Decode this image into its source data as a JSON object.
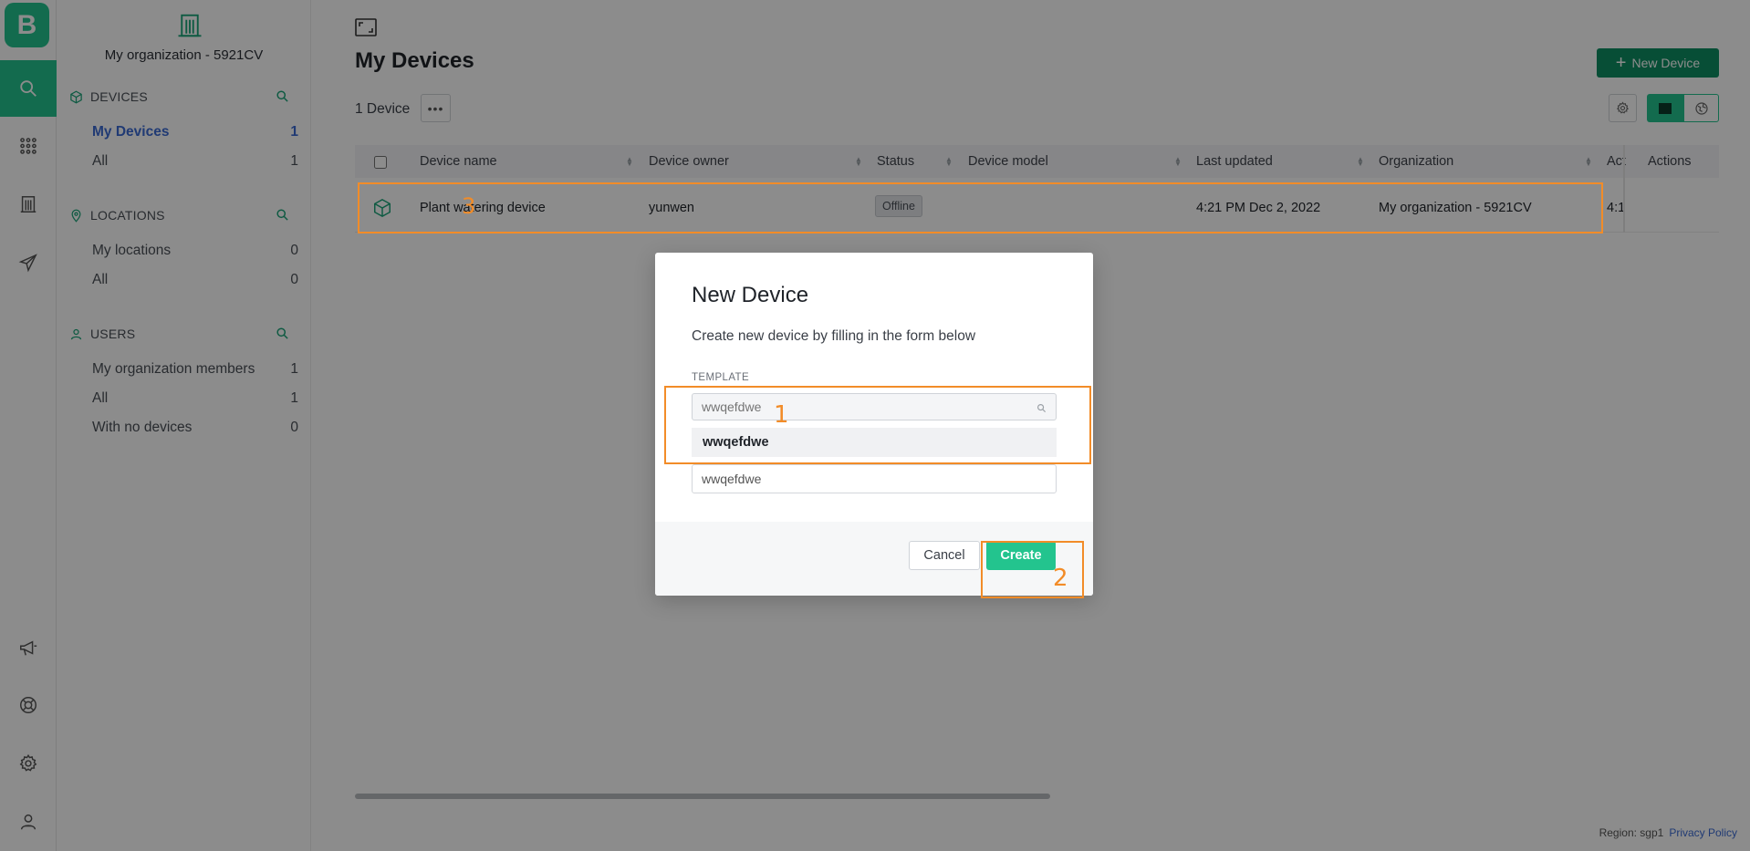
{
  "brand": {
    "logo_letter": "B",
    "accent": "#23c48e",
    "dark_accent": "#0e8f63",
    "annotation": "#f28c28"
  },
  "rail": {
    "icons": [
      "search-icon",
      "apps-grid-icon",
      "building-icon",
      "send-icon",
      "megaphone-icon",
      "lifebuoy-icon",
      "gear-icon",
      "user-icon"
    ],
    "active": "search-icon"
  },
  "sidebar": {
    "org_name": "My organization - 5921CV",
    "devices": {
      "header": "DEVICES",
      "items": [
        {
          "label": "My Devices",
          "count": "1",
          "active": true
        },
        {
          "label": "All",
          "count": "1"
        }
      ]
    },
    "locations": {
      "header": "LOCATIONS",
      "items": [
        {
          "label": "My locations",
          "count": "0"
        },
        {
          "label": "All",
          "count": "0"
        }
      ]
    },
    "users": {
      "header": "USERS",
      "items": [
        {
          "label": "My organization members",
          "count": "1"
        },
        {
          "label": "All",
          "count": "1"
        },
        {
          "label": "With no devices",
          "count": "0"
        }
      ]
    }
  },
  "main": {
    "title": "My Devices",
    "new_button": "New Device",
    "count_label": "1 Device",
    "more_label": "•••",
    "table": {
      "columns": [
        "Device name",
        "Device owner",
        "Status",
        "Device model",
        "Last updated",
        "Organization",
        "Act",
        "Actions"
      ],
      "rows": [
        {
          "name": "Plant watering device",
          "owner": "yunwen",
          "status": "Offline",
          "model": "",
          "last_updated": "4:21 PM Dec 2, 2022",
          "organization": "My organization - 5921CV",
          "act": "4:1"
        }
      ]
    }
  },
  "modal": {
    "title": "New Device",
    "description": "Create new device by filling in the form below",
    "template_label": "TEMPLATE",
    "template_placeholder": "wwqefdwe",
    "dropdown_option": "wwqefdwe",
    "name_value": "wwqefdwe",
    "cancel": "Cancel",
    "create": "Create"
  },
  "annotations": [
    "1",
    "2",
    "3"
  ],
  "footer": {
    "region": "Region: sgp1",
    "privacy": "Privacy Policy"
  }
}
